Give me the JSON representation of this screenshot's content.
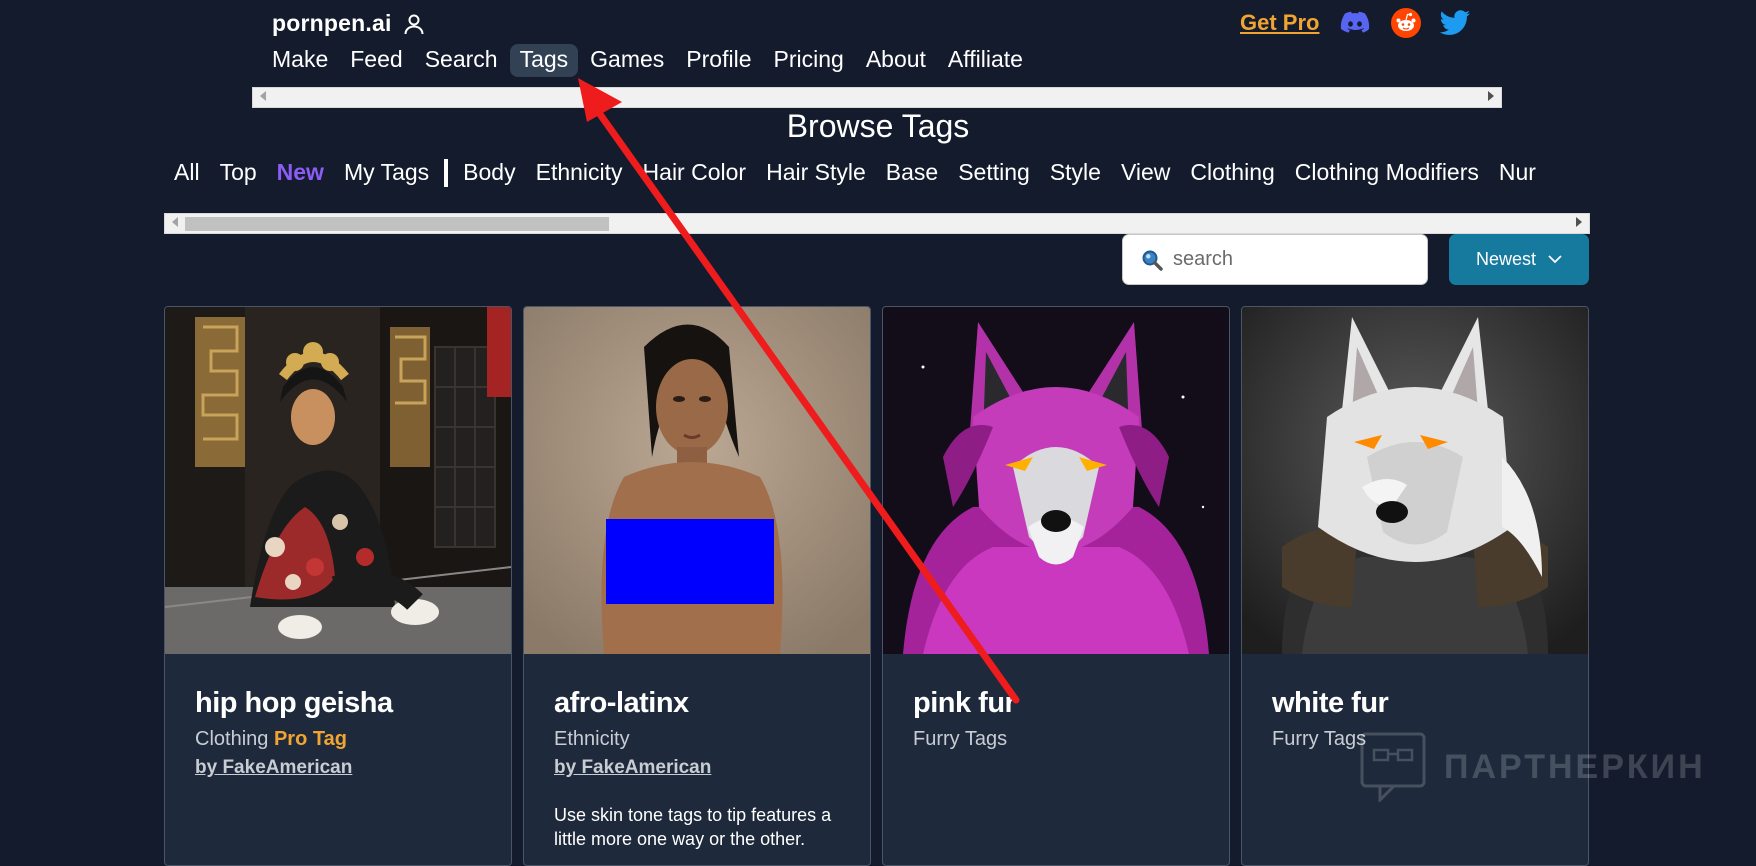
{
  "header": {
    "brand": "pornpen.ai",
    "get_pro": "Get Pro",
    "nav": [
      "Make",
      "Feed",
      "Search",
      "Tags",
      "Games",
      "Profile",
      "Pricing",
      "About",
      "Affiliate"
    ],
    "active_nav": "Tags"
  },
  "browse": {
    "title": "Browse Tags",
    "categories_before_sep": [
      "All",
      "Top",
      "New",
      "My Tags"
    ],
    "categories_after_sep": [
      "Body",
      "Ethnicity",
      "Hair Color",
      "Hair Style",
      "Base",
      "Setting",
      "Style",
      "View",
      "Clothing",
      "Clothing Modifiers",
      "Nur"
    ],
    "active_category": "New"
  },
  "search": {
    "placeholder": "search"
  },
  "sort": {
    "label": "Newest"
  },
  "cards": [
    {
      "title": "hip hop geisha",
      "category": "Clothing",
      "badge": "Pro Tag",
      "author": "by FakeAmerican",
      "description": ""
    },
    {
      "title": "afro-latinx",
      "category": "Ethnicity",
      "badge": "",
      "author": "by FakeAmerican",
      "description": "Use skin tone tags to tip features a little more one way or the other."
    },
    {
      "title": "pink fur",
      "category": "Furry Tags",
      "badge": "",
      "author": "",
      "description": ""
    },
    {
      "title": "white fur",
      "category": "Furry Tags",
      "badge": "",
      "author": "",
      "description": ""
    }
  ],
  "watermark": "ПАРТНЕРКИН",
  "colors": {
    "background": "#141b2d",
    "card": "#1e293b",
    "accent_orange": "#f0a432",
    "accent_purple": "#8b5cf6",
    "button_teal": "#167a9e",
    "annotation_arrow": "#ee1c1c"
  },
  "icons": [
    "user-icon",
    "discord-icon",
    "reddit-icon",
    "twitter-icon",
    "search-icon",
    "chevron-down-icon"
  ]
}
